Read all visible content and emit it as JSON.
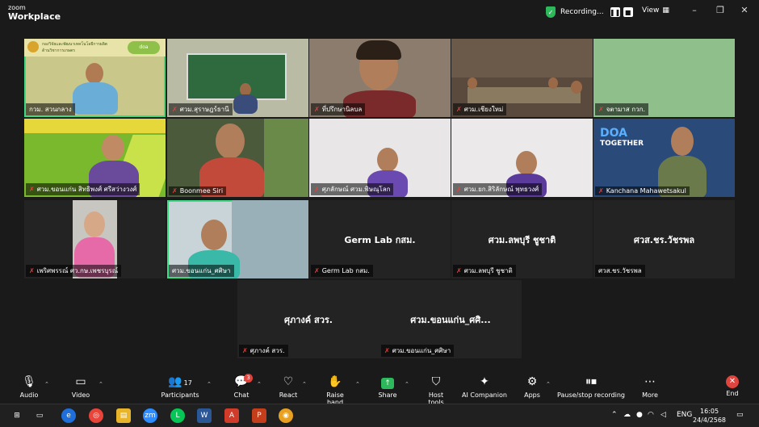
{
  "app": {
    "brand_small": "zoom",
    "brand_large": "Workplace"
  },
  "titlebar": {
    "recording_label": "Recording...",
    "pause_glyph": "❚❚",
    "stop_glyph": "■",
    "view_label": "View",
    "view_icon": "grid-icon"
  },
  "participants": [
    {
      "name": "กวม. สวนกลาง",
      "muted": false
    },
    {
      "name": "ศวม.สุราษฎร์ธานี",
      "muted": true
    },
    {
      "name": "ที่ปรึกษานิลบล",
      "muted": true
    },
    {
      "name": "ศวม.เชียงใหม่",
      "muted": true
    },
    {
      "name": "จตามาส กวก.",
      "muted": true
    },
    {
      "name": "ศวม.ขอนแก่น สิทธิพงศ์ ศรีสว่างวงศ์",
      "muted": true
    },
    {
      "name": "Boonmee Siri",
      "muted": true
    },
    {
      "name": "ศุภลักษณ์ ศวม.พิษณุโลก",
      "muted": true
    },
    {
      "name": "ศวม.ยก.สิริลักษณ์ พุทธวงศ์",
      "muted": true
    },
    {
      "name": "Kanchana Mahawetsakul",
      "muted": true
    },
    {
      "name": "เพริศพรรณ์ ศว.กษ.เพชรบุรณ์",
      "muted": true
    },
    {
      "name": "ศวม.ขอนแก่น_ศศิษา",
      "muted": false
    },
    {
      "name": "Germ Lab กสม.",
      "muted": true,
      "display": "Germ Lab กสม."
    },
    {
      "name": "ศวม.ลพบุรี ชูชาติ",
      "muted": true,
      "display": "ศวม.ลพบุรี ชูชาติ"
    },
    {
      "name": "ศวส.ชร.วัชรพล",
      "muted": false,
      "display": "ศวส.ชร.วัชรพล"
    },
    {
      "name": "ศุภางค์ สวร.",
      "muted": true,
      "display": "ศุภางค์ สวร."
    },
    {
      "name": "ศวม.ขอนแก่น_ศศิษา",
      "muted": true,
      "display": "ศวม.ขอนแก่น_ศศิ..."
    }
  ],
  "tile_texts": {
    "slide1_title": "กองวิจัยและพัฒนาเทคโนโลยีการผลิต",
    "slide1_sub": "ด้านวิชาการเกษตร",
    "slide1_logo": "doa",
    "doa_big": "DOA",
    "doa_small": "TOGETHER"
  },
  "toolbar": {
    "audio": "Audio",
    "video": "Video",
    "participants": "Participants",
    "participants_count": "17",
    "chat": "Chat",
    "chat_badge": "3",
    "react": "React",
    "raise_hand": "Raise hand",
    "share": "Share",
    "host_tools": "Host tools",
    "ai_companion": "AI Companion",
    "apps": "Apps",
    "pause_stop": "Pause/stop recording",
    "more": "More",
    "end": "End"
  },
  "taskbar": {
    "lang": "ENG",
    "time": "16:05",
    "date": "24/4/2568"
  },
  "colors": {
    "accent_green": "#3ddc84",
    "mute_red": "#e0443e",
    "end_red": "#e0443e"
  }
}
